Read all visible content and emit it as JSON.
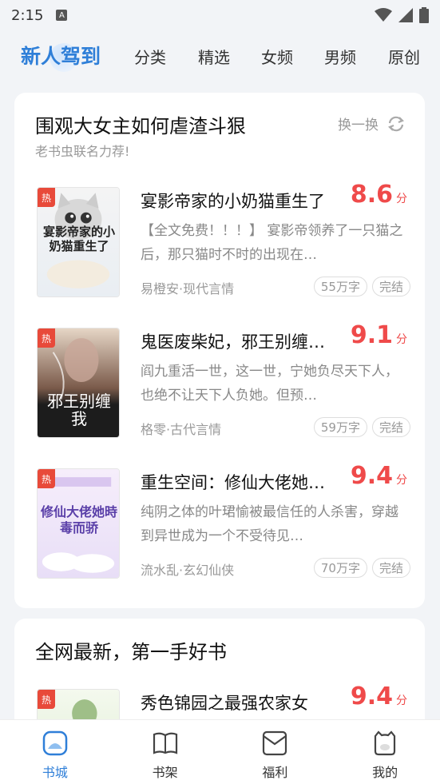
{
  "status": {
    "time": "2:15",
    "a_label": "A"
  },
  "tabs": [
    {
      "label": "新人驾到",
      "active": true
    },
    {
      "label": "分类"
    },
    {
      "label": "精选"
    },
    {
      "label": "女频"
    },
    {
      "label": "男频"
    },
    {
      "label": "原创"
    }
  ],
  "section1": {
    "title": "围观大女主如何虐渣斗狠",
    "subtitle": "老书虫联名力荐!",
    "refresh_label": "换一换",
    "books": [
      {
        "hot": "热",
        "title": "宴影帝家的小奶猫重生了",
        "score": "8.6",
        "score_unit": "分",
        "desc": "【全文免费！！！】 宴影帝领养了一只猫之后，那只猫时不时的出现在…",
        "meta": "易橙安·现代言情",
        "words": "55万字",
        "status": "完结"
      },
      {
        "hot": "热",
        "title": "鬼医废柴妃，邪王别缠…",
        "score": "9.1",
        "score_unit": "分",
        "desc": "阎九重活一世，这一世，宁她负尽天下人，也绝不让天下人负她。但预…",
        "meta": "格零·古代言情",
        "words": "59万字",
        "status": "完结"
      },
      {
        "hot": "热",
        "title": "重生空间：修仙大佬她…",
        "score": "9.4",
        "score_unit": "分",
        "desc": "纯阴之体的叶珺愉被最信任的人杀害，穿越到异世成为一个不受待见…",
        "meta": "流水乱·玄幻仙侠",
        "words": "70万字",
        "status": "完结"
      }
    ]
  },
  "section2": {
    "title": "全网最新，第一手好书",
    "books": [
      {
        "hot": "热",
        "title": "秀色锦园之最强农家女",
        "score": "9.4",
        "score_unit": "分"
      }
    ]
  },
  "cover_text": {
    "c1": "宴影帝家的小奶猫重生了",
    "c2": "邪王别缠我",
    "c3": "修仙大佬她時毒而骄"
  },
  "nav": [
    {
      "label": "书城",
      "icon": "bookstore-icon",
      "active": true
    },
    {
      "label": "书架",
      "icon": "bookshelf-icon"
    },
    {
      "label": "福利",
      "icon": "welfare-icon"
    },
    {
      "label": "我的",
      "icon": "profile-icon"
    }
  ],
  "colors": {
    "accent": "#2f7fd8",
    "score": "#ef4a4a",
    "hot": "#e84a3a"
  }
}
